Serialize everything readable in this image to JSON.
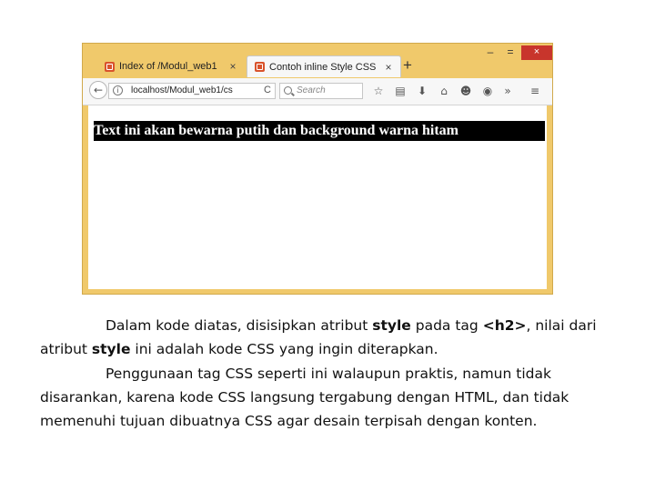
{
  "browser": {
    "tabs": [
      {
        "title": "Index of /Modul_web1",
        "close": "×"
      },
      {
        "title": "Contoh inline Style CSS",
        "close": "×"
      }
    ],
    "new_tab": "+",
    "window_controls": {
      "minimize": "–",
      "maximize": "=",
      "close": "×"
    },
    "nav": {
      "back": "←",
      "info": "i",
      "url": "localhost/Modul_web1/cs",
      "reload": "C",
      "search_placeholder": "Search"
    },
    "toolbar_icons": [
      "star-icon",
      "reading-list-icon",
      "download-icon",
      "home-icon",
      "pocket-icon",
      "browse-icon",
      "overflow-icon",
      "menu-icon"
    ],
    "toolbar_glyphs": {
      "star": "☆",
      "reading": "▤",
      "download": "⬇",
      "home": "⌂",
      "pocket": "☻",
      "browse": "◉",
      "overflow": "»",
      "menu": "≡"
    },
    "page_heading": "Text ini akan bewarna putih dan background warna hitam"
  },
  "caption": {
    "p1_a": "Dalam kode diatas, disisipkan atribut ",
    "p1_b": "style",
    "p1_c": " pada tag ",
    "p1_d": "<h2>",
    "p1_e": ", nilai dari atribut ",
    "p1_f": "style",
    "p1_g": " ini adalah kode CSS yang ingin diterapkan.",
    "p2": "Penggunaan tag CSS seperti ini walaupun praktis, namun tidak disarankan, karena kode CSS langsung tergabung dengan HTML, dan tidak memenuhi tujuan dibuatnya CSS agar desain terpisah dengan konten."
  },
  "colors": {
    "window_frame": "#f0c96b",
    "close_button": "#c8352c",
    "heading_bg": "#000000"
  }
}
